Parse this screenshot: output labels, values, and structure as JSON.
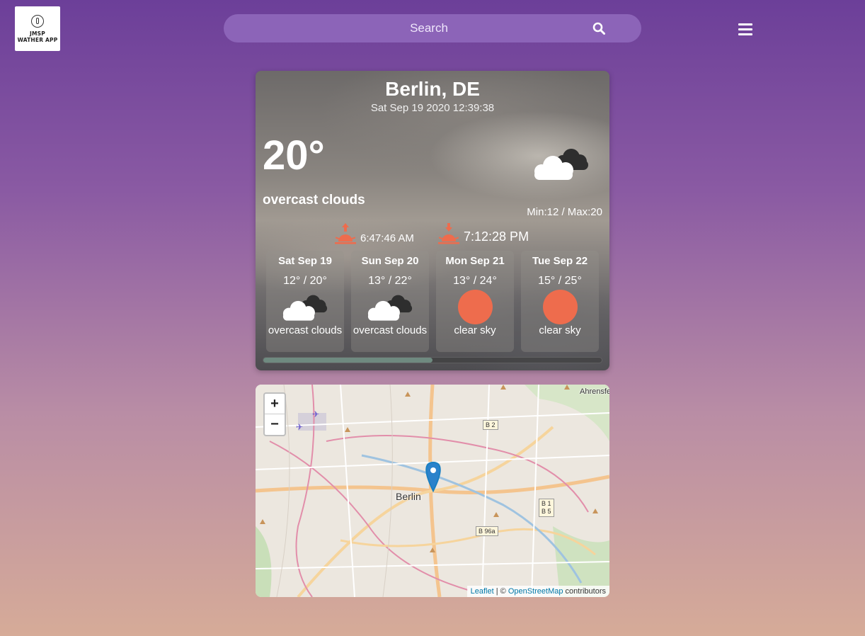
{
  "header": {
    "logo_line1": "JMSP",
    "logo_line2": "WATHER APP",
    "search_placeholder": "Search"
  },
  "current": {
    "city": "Berlin, DE",
    "datetime": "Sat Sep 19 2020 12:39:38",
    "temperature": "20°",
    "condition": "overcast clouds",
    "minmax": "Min:12 / Max:20",
    "sunrise": "6:47:46 AM",
    "sunset": "7:12:28 PM",
    "icon": "overcast-clouds-icon"
  },
  "forecast": [
    {
      "day": "Sat Sep 19",
      "range": "12° / 20°",
      "condition": "overcast clouds",
      "icon": "overcast-clouds-icon"
    },
    {
      "day": "Sun Sep 20",
      "range": "13° / 22°",
      "condition": "overcast clouds",
      "icon": "overcast-clouds-icon"
    },
    {
      "day": "Mon Sep 21",
      "range": "13° / 24°",
      "condition": "clear sky",
      "icon": "sun-icon"
    },
    {
      "day": "Tue Sep 22",
      "range": "15° / 25°",
      "condition": "clear sky",
      "icon": "sun-icon"
    }
  ],
  "forecast_scroll_fraction": 0.5,
  "map": {
    "zoom_in": "+",
    "zoom_out": "−",
    "city_label": "Berlin",
    "corner_label": "Ahrensfe",
    "road_b2": "B 2",
    "road_b1": "B 1",
    "road_b5": "B 5",
    "road_b96a": "B 96a",
    "attribution_leaflet": "Leaflet",
    "attribution_sep": " | © ",
    "attribution_osm": "OpenStreetMap",
    "attribution_suffix": " contributors"
  },
  "colors": {
    "accent_sun": "#ee6c4d",
    "search_bg": "#8c64b8"
  }
}
